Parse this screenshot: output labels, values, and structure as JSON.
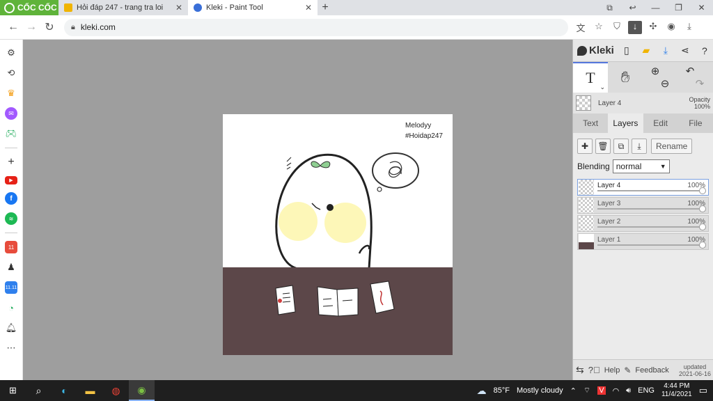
{
  "browser": {
    "brand": "CỐC CỐC",
    "tabs": [
      {
        "title": "Hỏi đáp 247 - trang tra loi",
        "active": false,
        "favicon_color": "#f0b400"
      },
      {
        "title": "Kleki - Paint Tool",
        "active": true,
        "favicon_color": "#3a6fd8"
      }
    ],
    "url": "kleki.com"
  },
  "sidebar_icons": [
    "gear-icon",
    "history-icon",
    "crown-icon",
    "messenger-icon",
    "games-icon",
    "plus-icon",
    "youtube-icon",
    "facebook-icon",
    "spotify-icon",
    "shop-icon",
    "avatar-icon",
    "sale-icon",
    "maps-icon",
    "bell-icon",
    "more-icon"
  ],
  "canvas": {
    "watermark_line1": "Melodyy",
    "watermark_line2": "#Hoidap247",
    "colors": {
      "table": "#5c4749",
      "cheek": "#fdf7b8",
      "leaf": "#8fcf92",
      "background": "#ffffff"
    }
  },
  "kleki": {
    "logo": "Kleki",
    "current_tool": "Text",
    "current_layer": "Layer 4",
    "opacity_label": "Opacity",
    "opacity_value": "100%",
    "tabs": [
      "Text",
      "Layers",
      "Edit",
      "File"
    ],
    "active_tab": "Layers",
    "rename_label": "Rename",
    "blending_label": "Blending",
    "blending_value": "normal",
    "layers": [
      {
        "name": "Layer 4",
        "opacity": "100%",
        "active": true
      },
      {
        "name": "Layer 3",
        "opacity": "100%",
        "active": false
      },
      {
        "name": "Layer 2",
        "opacity": "100%",
        "active": false
      },
      {
        "name": "Layer 1",
        "opacity": "100%",
        "active": false
      }
    ],
    "help_label": "Help",
    "feedback_label": "Feedback",
    "updated_line1": "updated",
    "updated_line2": "2021-06-16"
  },
  "taskbar": {
    "weather_temp": "85°F",
    "weather_desc": "Mostly cloudy",
    "language": "ENG",
    "time": "4:44 PM",
    "date": "11/4/2021"
  }
}
